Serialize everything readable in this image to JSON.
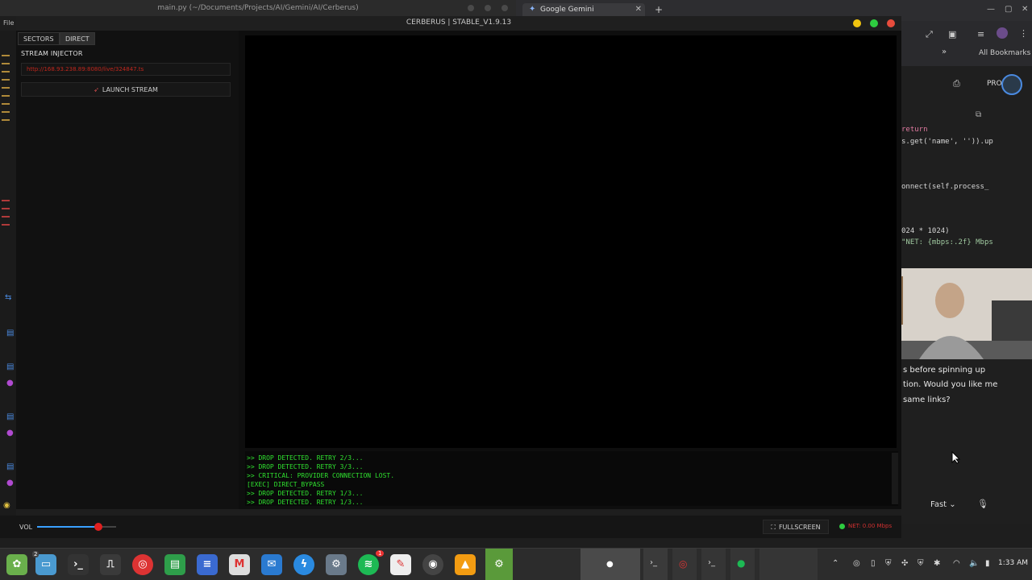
{
  "editor": {
    "title": "main.py (~/Documents/Projects/AI/Gemini/AI/Cerberus)",
    "file_menu": "File"
  },
  "browser": {
    "tab_title": "Google Gemini",
    "bookmarks": "All Bookmarks",
    "pro_badge": "PRO",
    "code_lines": [
      "return",
      "s.get('name', '')).up",
      "onnect(self.process_",
      "024 * 1024)",
      "\"NET: {mbps:.2f} Mbps"
    ],
    "chat_lines": [
      "s before spinning up",
      "tion. Would you like me",
      "same links?"
    ],
    "model_selector": "Fast"
  },
  "app": {
    "title": "CERBERUS | STABLE_V1.9.13",
    "tabs": [
      {
        "label": "SECTORS",
        "active": false
      },
      {
        "label": "DIRECT",
        "active": true
      }
    ],
    "stream_injector_label": "STREAM INJECTOR",
    "url_value": "http://168.93.238.89:8080/live/324847.ts",
    "launch_label": "LAUNCH STREAM",
    "console_lines": [
      ">> DROP DETECTED. RETRY 2/3...",
      ">> DROP DETECTED. RETRY 3/3...",
      ">> CRITICAL: PROVIDER CONNECTION LOST.",
      "[EXEC] DIRECT_BYPASS",
      ">> DROP DETECTED. RETRY 1/3...",
      ">> DROP DETECTED. RETRY 1/3..."
    ],
    "volume_label": "VOL",
    "volume_level": 0.78,
    "fullscreen_label": "FULLSCREEN",
    "net_status": "NET: 0.00 Mbps",
    "colors": {
      "accent_red": "#e02020",
      "console_green": "#2fe02f",
      "net_green": "#2ecc40"
    }
  },
  "taskbar": {
    "clock": "1:33 AM",
    "badge_count": "2",
    "spotify_badge": "1",
    "icons": [
      "mint-menu-icon",
      "files-icon",
      "terminal-icon",
      "monitor-icon",
      "chrome-icon",
      "chat-icon",
      "docs-icon",
      "gmail-icon",
      "email-icon",
      "messenger-icon",
      "archive-icon",
      "spotify-icon",
      "text-editor-icon",
      "obs-icon",
      "vlc-icon",
      "settings-icon"
    ]
  }
}
